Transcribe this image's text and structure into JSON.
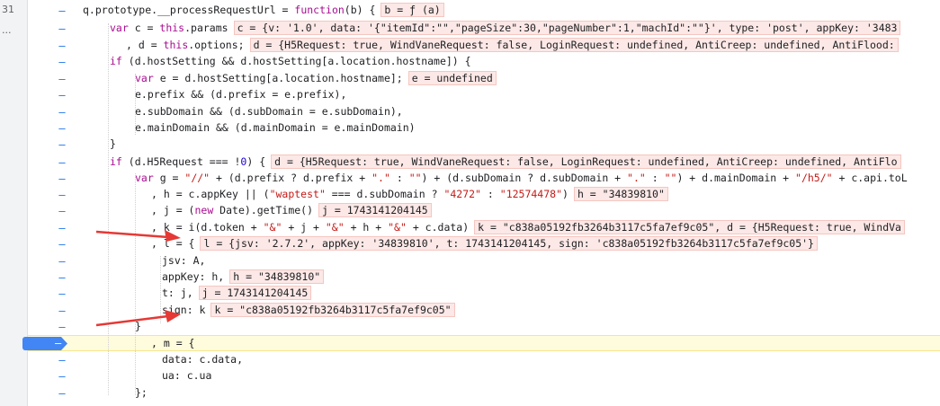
{
  "gutter": {
    "top_number": "31",
    "ellipsis": "···"
  },
  "lines": [
    {
      "t": "q.prototype.__processRequestUrl = function(b) {",
      "v": "b = ƒ (a)"
    },
    {
      "t": "var c = this.params",
      "v": "c = {v: '1.0', data: '{\"itemId\":\"\",\"pageSize\":30,\"pageNumber\":1,\"machId\":\"\"}', type: 'post', appKey: '3483"
    },
    {
      "t": ", d = this.options;",
      "v": "d = {H5Request: true, WindVaneRequest: false, LoginRequest: undefined, AntiCreep: undefined, AntiFlood:"
    },
    {
      "t": "if (d.hostSetting && d.hostSetting[a.location.hostname]) {",
      "v": ""
    },
    {
      "t": "var e = d.hostSetting[a.location.hostname];",
      "v": "e = undefined"
    },
    {
      "t": "e.prefix && (d.prefix = e.prefix),",
      "v": ""
    },
    {
      "t": "e.subDomain && (d.subDomain = e.subDomain),",
      "v": ""
    },
    {
      "t": "e.mainDomain && (d.mainDomain = e.mainDomain)",
      "v": ""
    },
    {
      "t": "}",
      "v": ""
    },
    {
      "t": "if (d.H5Request === !0) {",
      "v": "d = {H5Request: true, WindVaneRequest: false, LoginRequest: undefined, AntiCreep: undefined, AntiFlo"
    },
    {
      "t": "var g = \"//\" + (d.prefix ? d.prefix + \".\" : \"\") + (d.subDomain ? d.subDomain + \".\" : \"\") + d.mainDomain + \"/h5/\" + c.api.toL",
      "v": ""
    },
    {
      "t": ", h = c.appKey || (\"waptest\" === d.subDomain ? \"4272\" : \"12574478\")",
      "v": "h = \"34839810\""
    },
    {
      "t": ", j = (new Date).getTime()",
      "v": "j = 1743141204145"
    },
    {
      "t": ", k = i(d.token + \"&\" + j + \"&\" + h + \"&\" + c.data)",
      "v": "k = \"c838a05192fb3264b3117c5fa7ef9c05\", d = {H5Request: true, WindVa"
    },
    {
      "t": ", l = {",
      "v": "l = {jsv: '2.7.2', appKey: '34839810', t: 1743141204145, sign: 'c838a05192fb3264b3117c5fa7ef9c05'}"
    },
    {
      "t": "jsv: A,",
      "v": ""
    },
    {
      "t": "appKey: h,",
      "v": "h = \"34839810\""
    },
    {
      "t": "t: j,",
      "v": "j = 1743141204145"
    },
    {
      "t": "sign: k",
      "v": "k = \"c838a05192fb3264b3117c5fa7ef9c05\""
    },
    {
      "t": "}",
      "v": ""
    },
    {
      "t": ", m = {",
      "v": ""
    },
    {
      "t": "data: c.data,",
      "v": ""
    },
    {
      "t": "ua: c.ua",
      "v": ""
    },
    {
      "t": "};",
      "v": ""
    }
  ],
  "colors": {
    "highlight_line": "#fffbdd",
    "value_bg": "#fce8e6",
    "breakpoint": "#4285f4",
    "arrow": "#e53935"
  },
  "minus_glyph": "–"
}
